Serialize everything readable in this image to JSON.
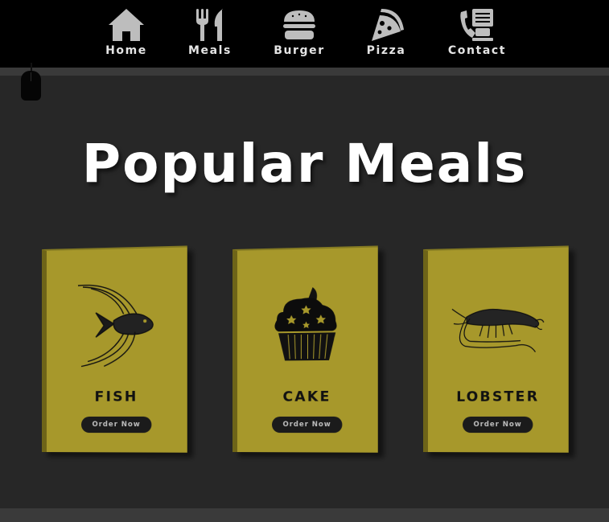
{
  "nav": {
    "items": [
      {
        "label": "Home",
        "icon": "home-icon"
      },
      {
        "label": "Meals",
        "icon": "fork-knife-icon"
      },
      {
        "label": "Burger",
        "icon": "burger-icon"
      },
      {
        "label": "Pizza",
        "icon": "pizza-icon"
      },
      {
        "label": "Contact",
        "icon": "phone-icon"
      }
    ]
  },
  "main": {
    "title": "Popular Meals"
  },
  "cards": [
    {
      "name": "FISH",
      "icon": "fish-icon",
      "button_label": "Order Now"
    },
    {
      "name": "CAKE",
      "icon": "cupcake-icon",
      "button_label": "Order Now"
    },
    {
      "name": "LOBSTER",
      "icon": "lobster-icon",
      "button_label": "Order Now"
    }
  ],
  "colors": {
    "navbar_bg": "#000000",
    "page_bg": "#272727",
    "card_bg": "#a7982b",
    "button_bg": "#1b1b1b",
    "title_text": "#ffffff",
    "nav_icon": "#bdbdbd"
  }
}
